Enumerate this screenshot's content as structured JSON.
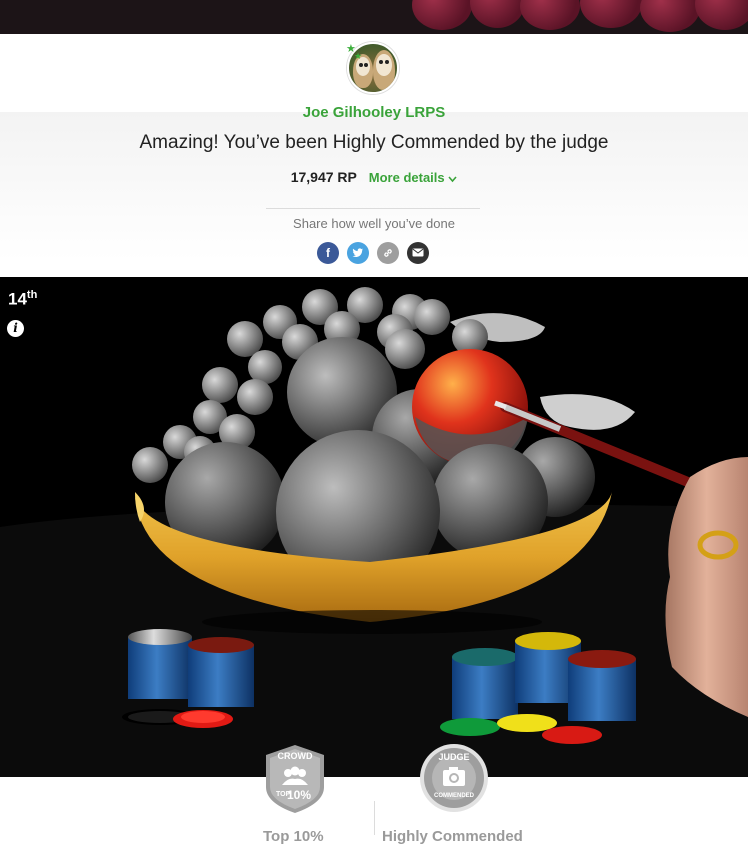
{
  "header": {
    "username": "Joe Gilhooley LRPS"
  },
  "result": {
    "headline": "Amazing! You’ve been Highly Commended by the judge",
    "points": "17,947 RP",
    "more_details": "More details",
    "share_label": "Share how well you’ve done",
    "share_icons": [
      "facebook-icon",
      "twitter-icon",
      "link-icon",
      "email-icon"
    ]
  },
  "photo": {
    "rank_number": "14",
    "rank_suffix": "th"
  },
  "badges": {
    "crowd": {
      "badge_title": "CROWD",
      "badge_top": "TOP",
      "badge_pct": "10%",
      "label": "Top 10%"
    },
    "judge": {
      "badge_title": "JUDGE",
      "badge_sub": "COMMENDED",
      "label": "Highly Commended"
    }
  },
  "colors": {
    "accent_green": "#3aa33a",
    "facebook": "#3b5998",
    "twitter": "#4aa3e0",
    "link": "#9e9e9e",
    "email": "#333333"
  }
}
